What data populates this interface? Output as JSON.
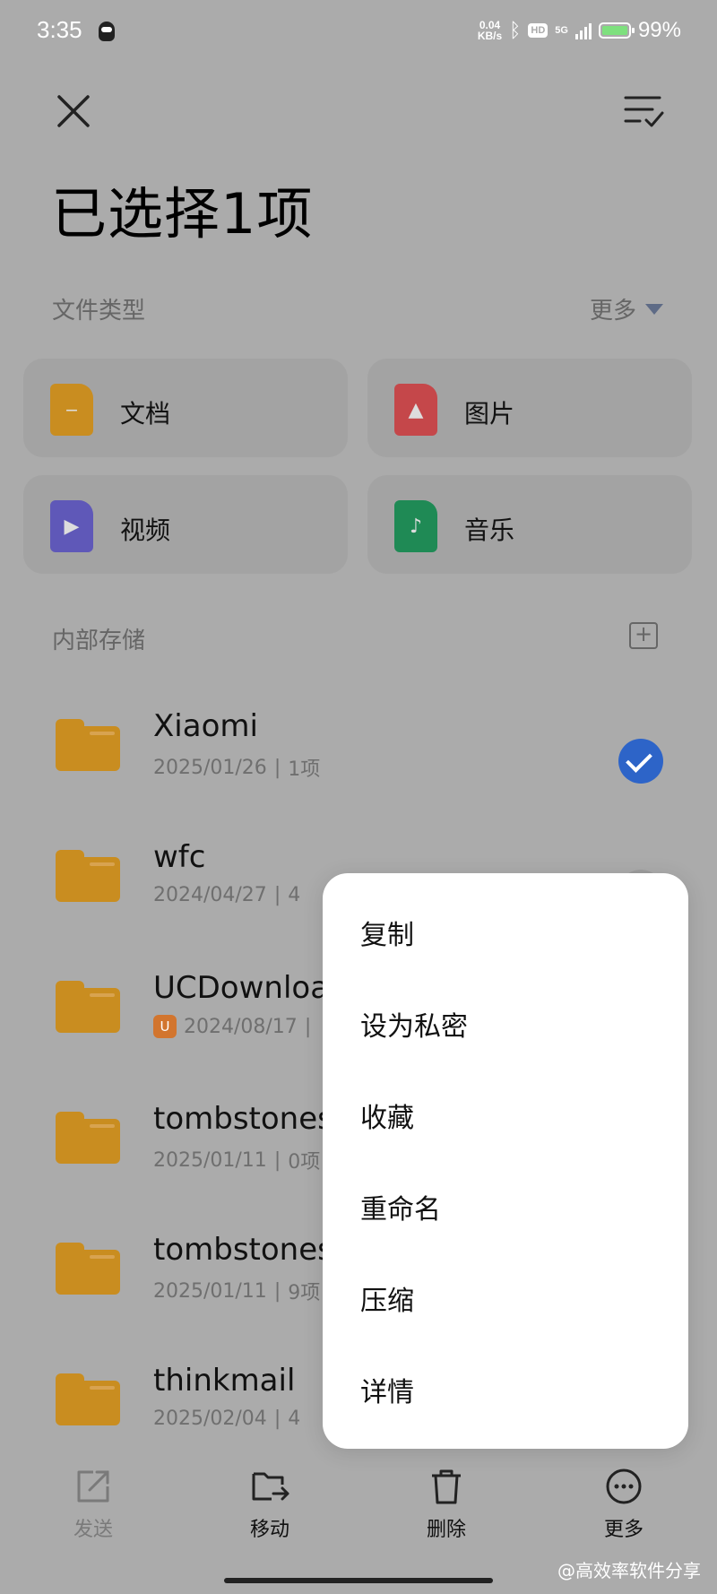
{
  "status_bar": {
    "time": "3:35",
    "speed_value": "0.04",
    "speed_unit": "KB/s",
    "hd": "HD",
    "network": "5G",
    "battery": "99%"
  },
  "header": {
    "title": "已选择1项"
  },
  "file_types": {
    "section_label": "文件类型",
    "more_label": "更多",
    "tiles": [
      {
        "label": "文档",
        "icon": "document-icon",
        "color": "#c98d20"
      },
      {
        "label": "图片",
        "icon": "image-icon",
        "color": "#c5474a"
      },
      {
        "label": "视频",
        "icon": "video-icon",
        "color": "#5f58b8"
      },
      {
        "label": "音乐",
        "icon": "music-icon",
        "color": "#1f8a55"
      }
    ]
  },
  "storage": {
    "section_label": "内部存储",
    "files": [
      {
        "name": "Xiaomi",
        "date": "2025/01/26",
        "count": "1项",
        "selected": true
      },
      {
        "name": "wfc",
        "date": "2024/04/27",
        "count": "4",
        "selected": false
      },
      {
        "name": "UCDownloa",
        "date": "2024/08/17",
        "count": "",
        "selected": false
      },
      {
        "name": "tombstones",
        "date": "2025/01/11",
        "count": "0项",
        "selected": false
      },
      {
        "name": "tombstones",
        "date": "2025/01/11",
        "count": "9项",
        "selected": false
      },
      {
        "name": "thinkmail",
        "date": "2025/02/04",
        "count": "4",
        "selected": false
      }
    ]
  },
  "context_menu": {
    "items": [
      "复制",
      "设为私密",
      "收藏",
      "重命名",
      "压缩",
      "详情"
    ]
  },
  "bottom_bar": {
    "send": "发送",
    "move": "移动",
    "delete": "删除",
    "more": "更多"
  },
  "watermark": "@高效率软件分享",
  "colors": {
    "check_blue": "#2d64c8",
    "folder_orange": "#c98d20",
    "dim_overlay": "#ababab"
  }
}
